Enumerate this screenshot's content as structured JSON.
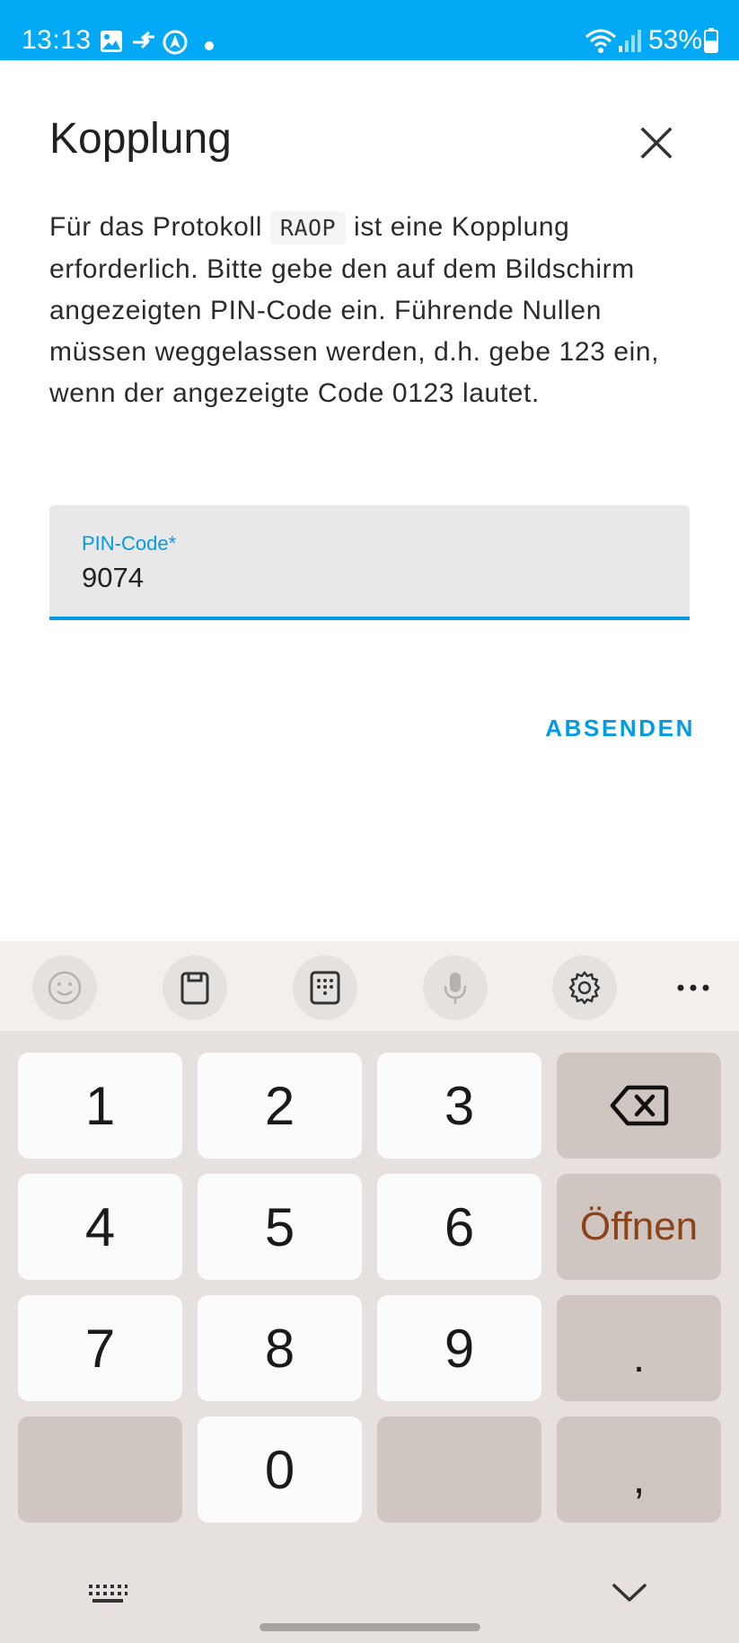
{
  "status_bar": {
    "time": "13:13",
    "battery_percent": "53%",
    "battery_level": 0.53,
    "icons": [
      "gallery-icon",
      "data-transfer-icon",
      "navigation-icon",
      "notification-dot-icon",
      "wifi-icon",
      "signal-icon",
      "battery-icon"
    ]
  },
  "dialog": {
    "title": "Kopplung",
    "description_before": "Für das Protokoll ",
    "protocol": "RAOP",
    "description_after": " ist eine Kopplung erforderlich. Bitte gebe den auf dem Bildschirm angezeigten PIN-Code ein. Führende Nullen müssen weggelassen werden, d.h. gebe 123 ein, wenn der angezeigte Code 0123 lautet.",
    "pin_label": "PIN-Code*",
    "pin_value": "9074",
    "submit_label": "ABSENDEN",
    "close_icon": "close-icon"
  },
  "keyboard": {
    "toolbar_icons": [
      "emoji-icon",
      "clipboard-icon",
      "keypad-icon",
      "microphone-icon",
      "settings-icon",
      "more-icon"
    ],
    "keys": {
      "k1": "1",
      "k2": "2",
      "k3": "3",
      "k4": "4",
      "k5": "5",
      "k6": "6",
      "k7": "7",
      "k8": "8",
      "k9": "9",
      "k0": "0",
      "open": "Öffnen",
      "period": ".",
      "comma": ","
    },
    "nav_icons": [
      "keyboard-switch-icon",
      "hide-keyboard-icon"
    ]
  },
  "colors": {
    "accent": "#039be5",
    "status_bar": "#03a9f4",
    "keyboard_bg": "#e6e1de",
    "key_gray": "#d0c6c1",
    "open_text": "#8a4418"
  }
}
